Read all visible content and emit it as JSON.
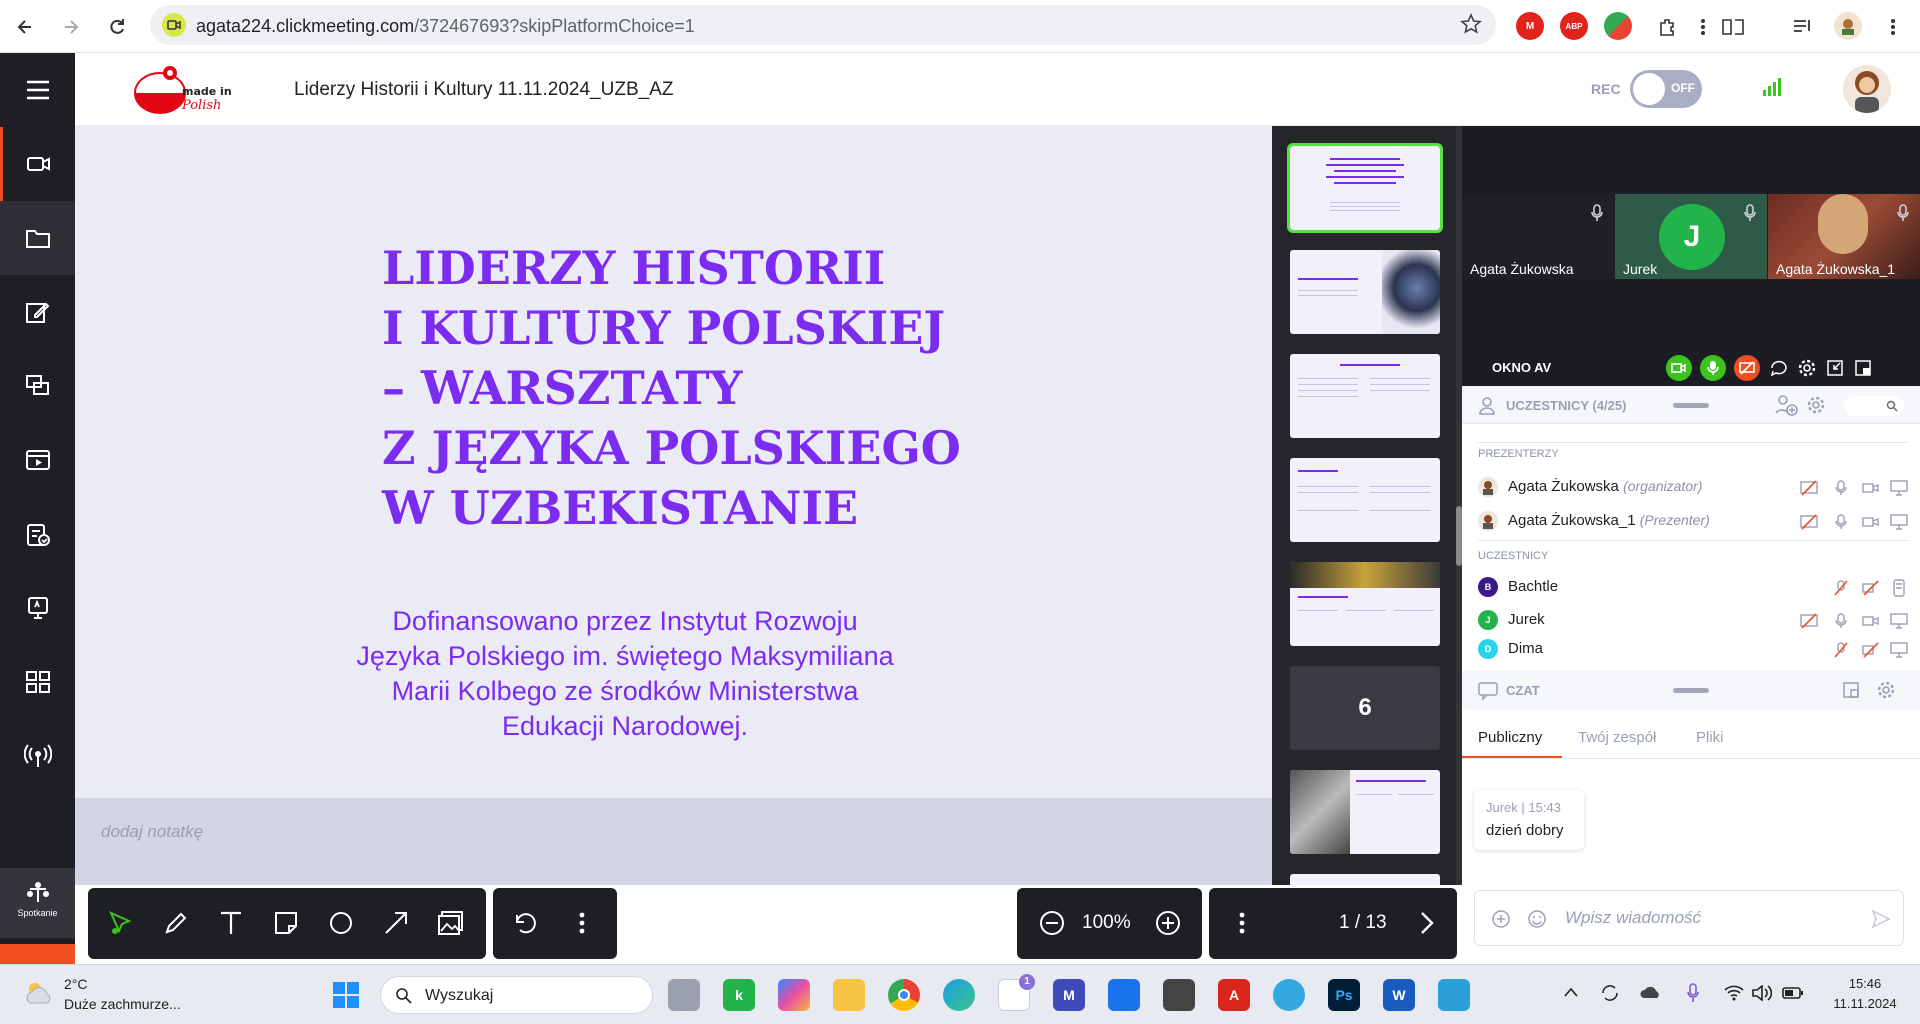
{
  "browser": {
    "url_host": "agata224.clickmeeting.com",
    "url_path": "/372467693?skipPlatformChoice=1"
  },
  "sidebar": {
    "items": [
      "video-icon",
      "folder-icon",
      "edit-icon",
      "screens-icon",
      "media-icon",
      "survey-icon",
      "whiteboard-icon",
      "apps-icon",
      "broadcast-icon"
    ],
    "spotkanie_label": "Spotkanie"
  },
  "header": {
    "logo_text": "made in Polish",
    "title": "Liderzy Historii i Kultury 11.11.2024_UZB_AZ",
    "rec_label": "REC",
    "rec_state": "OFF"
  },
  "slide": {
    "title": "LIDERZY HISTORII\nI KULTURY POLSKIEJ\n– WARSZTATY\nZ JĘZYKA POLSKIEGO\nW UZBEKISTANIE",
    "funding": "Dofinansowano przez Instytut Rozwoju\nJęzyka Polskiego im. świętego Maksymiliana\nMarii Kolbego ze środków Ministerstwa\nEdukacji Narodowej."
  },
  "notes": {
    "placeholder": "dodaj notatkę"
  },
  "thumbnails": {
    "active_index": 1,
    "loading_number": "6"
  },
  "zoom": {
    "value": "100%"
  },
  "pagination": {
    "indicator": "1 / 13"
  },
  "video": {
    "tiles": [
      {
        "name": "Agata Żukowska"
      },
      {
        "name": "Jurek",
        "initial": "J"
      },
      {
        "name": "Agata Żukowska_1"
      }
    ]
  },
  "av_window": {
    "title": "OKNO AV"
  },
  "participants": {
    "header": "UCZESTNICY (4/25)",
    "presenters_label": "PREZENTERZY",
    "attendees_label": "UCZESTNICY",
    "presenters": [
      {
        "name": "Agata Żukowska",
        "role": "(organizator)"
      },
      {
        "name": "Agata Żukowska_1",
        "role": "(Prezenter)"
      }
    ],
    "attendees": [
      {
        "name": "Bachtle",
        "initial": "B",
        "color": "#3a1a8a"
      },
      {
        "name": "Jurek",
        "initial": "J",
        "color": "#22b34a"
      },
      {
        "name": "Dima",
        "initial": "D",
        "color": "#2ad4e8"
      }
    ]
  },
  "chat": {
    "header": "CZAT",
    "tabs": [
      "Publiczny",
      "Twój zespół",
      "Pliki"
    ],
    "messages": [
      {
        "author": "Jurek",
        "time": "15:43",
        "text": "dzień dobry"
      }
    ],
    "compose_placeholder": "Wpisz wiadomość"
  },
  "taskbar": {
    "weather_temp": "2°C",
    "weather_desc": "Duże zachmurze...",
    "search_text": "Wyszukaj",
    "calendar_badge": "1",
    "time": "15:46",
    "date": "11.11.2024"
  },
  "colors": {
    "accent": "#f04e23",
    "slide_purple": "#7b2cf0",
    "active_thumb": "#54e53d",
    "sidebar_bg": "#1e1f24"
  }
}
